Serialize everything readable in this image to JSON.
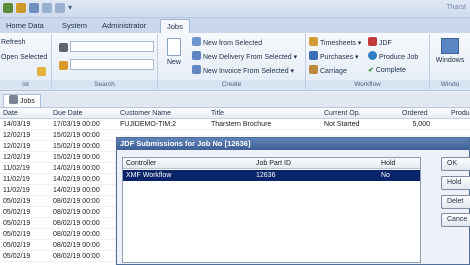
{
  "window": {
    "title": "Tharst"
  },
  "tabs": [
    "Home",
    "Data",
    "System",
    "Administrator",
    "Jobs"
  ],
  "ribbon": {
    "list_group": {
      "refresh": "Refresh",
      "open_selected": "Open Selected",
      "label": "ist"
    },
    "search_group": {
      "label": "Search"
    },
    "create_group": {
      "new": "New",
      "new_from_selected": "New from Selected",
      "new_delivery": "New Delivery From Selected",
      "new_invoice": "New Invoice From Selected",
      "label": "Create"
    },
    "workflow_group": {
      "timesheets": "Timesheets",
      "jdf": "JDF",
      "purchases": "Purchases",
      "produce_job": "Produce Job",
      "carriage": "Carriage",
      "complete": "Complete",
      "label": "Workflow"
    },
    "windows_group": {
      "windows": "Windows",
      "label": "Windo"
    }
  },
  "doc_tab": "Jobs",
  "grid": {
    "columns": [
      "Date",
      "Due Date",
      "Customer Name",
      "Title",
      "Current Op.",
      "Ordered",
      "Produ"
    ],
    "rows": [
      [
        "14/03/19",
        "17/03/19 00:00",
        "FUJIDEMO-TIM:2",
        "Tharstern Brochure",
        "Not Started",
        "5,000"
      ],
      [
        "12/02/19",
        "15/02/19 00:00",
        "",
        "",
        "",
        ""
      ],
      [
        "12/02/19",
        "15/02/19 00:00",
        "",
        "",
        "",
        ""
      ],
      [
        "12/02/19",
        "15/02/19 00:00",
        "",
        "",
        "",
        ""
      ],
      [
        "11/02/19",
        "14/02/19 00:00",
        "",
        "",
        "",
        ""
      ],
      [
        "11/02/19",
        "14/02/19 00:00",
        "",
        "",
        "",
        ""
      ],
      [
        "11/02/19",
        "14/02/19 00:00",
        "",
        "",
        "",
        ""
      ],
      [
        "05/02/19",
        "08/02/19 00:00",
        "",
        "",
        "",
        ""
      ],
      [
        "05/02/19",
        "08/02/19 00:00",
        "",
        "",
        "",
        ""
      ],
      [
        "05/02/19",
        "08/02/19 00:00",
        "",
        "",
        "",
        ""
      ],
      [
        "05/02/19",
        "08/02/19 00:00",
        "",
        "",
        "",
        ""
      ],
      [
        "05/02/19",
        "08/02/19 00:00",
        "",
        "",
        "",
        ""
      ],
      [
        "05/02/19",
        "08/02/19 00:00",
        "",
        "",
        "",
        ""
      ]
    ]
  },
  "dialog": {
    "title": "JDF Submissions for Job No [12636]",
    "columns": [
      "Controller",
      "Job Part ID",
      "Hold"
    ],
    "rows": [
      [
        "XMF Workflow",
        "12636",
        "No"
      ]
    ],
    "buttons": [
      "OK",
      "Hold",
      "Delet",
      "Cance"
    ]
  }
}
